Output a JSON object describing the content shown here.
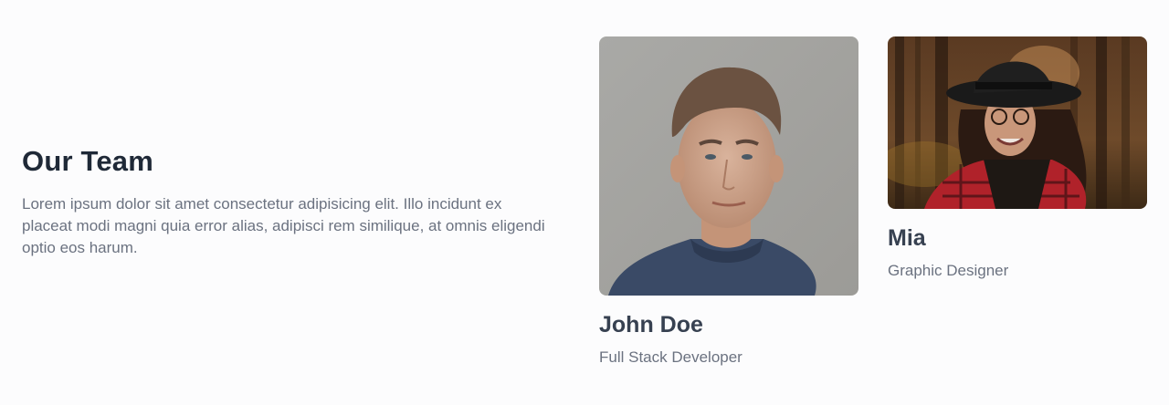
{
  "team": {
    "title": "Our Team",
    "description": "Lorem ipsum dolor sit amet consectetur adipisicing elit. Illo incidunt ex placeat modi magni quia error alias, adipisci rem similique, at omnis eligendi optio eos harum.",
    "members": [
      {
        "name": "John Doe",
        "role": "Full Stack Developer",
        "photo": "portrait-photo"
      },
      {
        "name": "Mia",
        "role": "Graphic Designer",
        "photo": "portrait-photo"
      }
    ]
  }
}
